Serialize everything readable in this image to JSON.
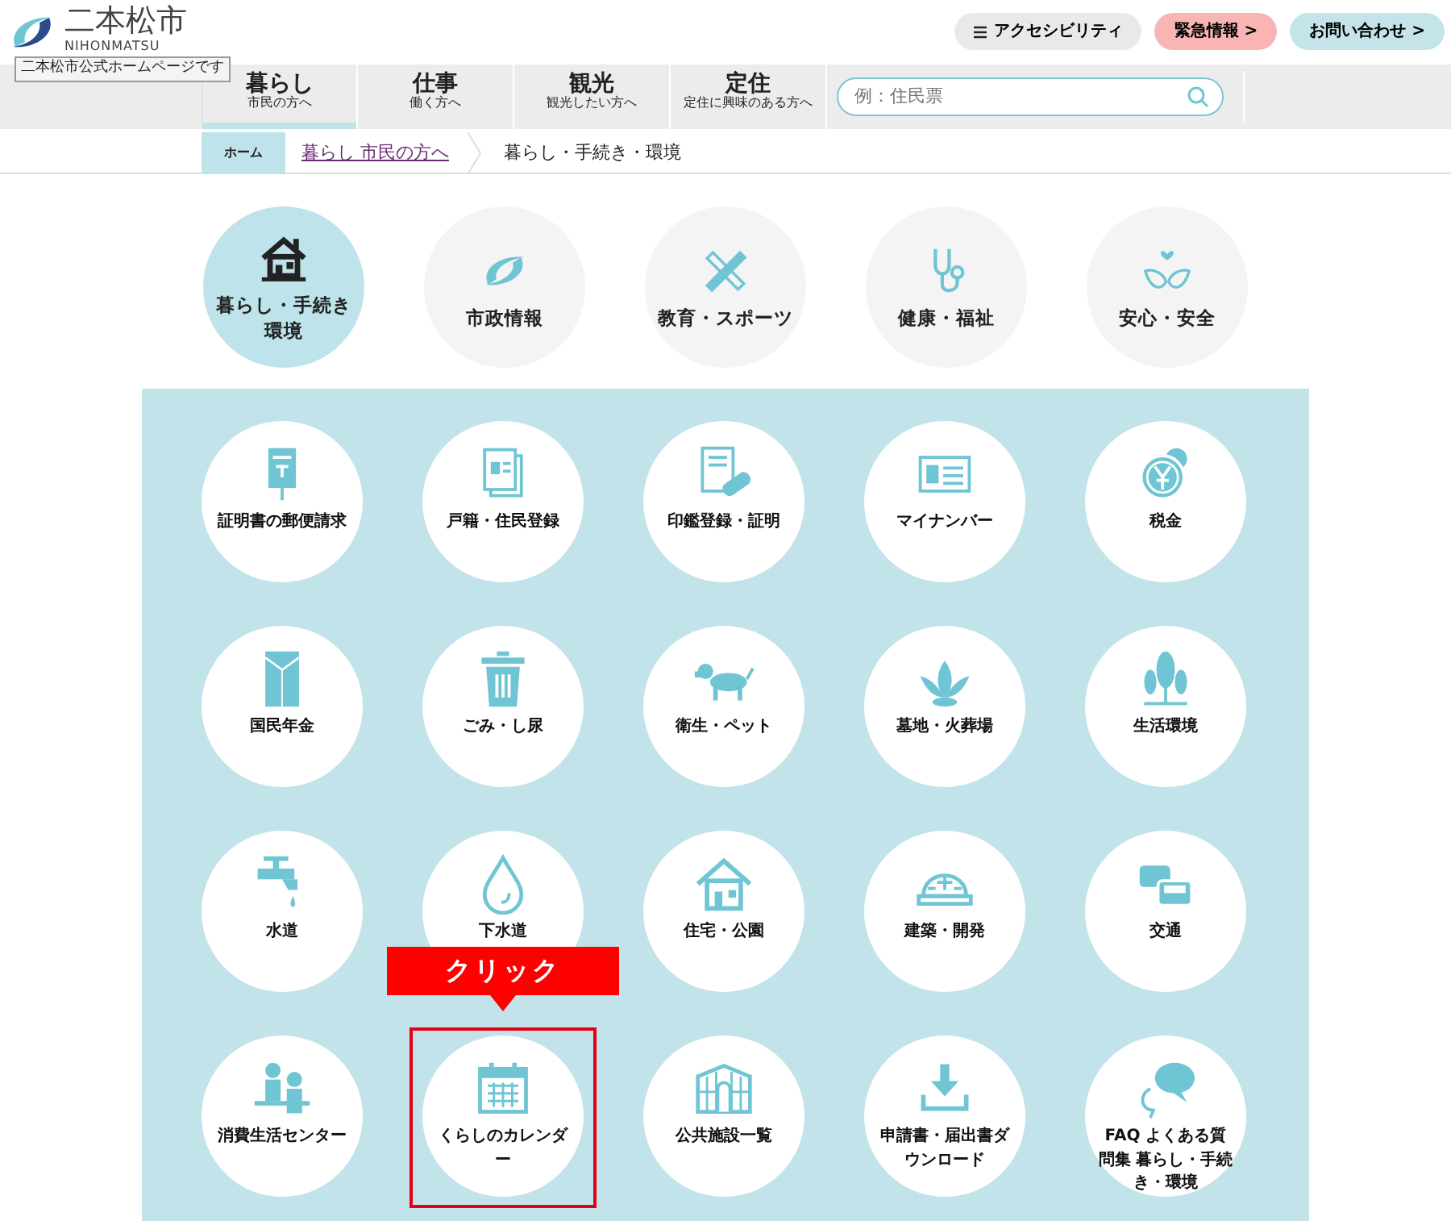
{
  "header": {
    "logo_text": "二本松市",
    "logo_subtext": "NIHONMATSU",
    "tooltip": "二本松市公式ホームページです",
    "buttons": [
      {
        "label": "アクセシビリティ",
        "kind": "menu"
      },
      {
        "label": "緊急情報 >",
        "kind": "alert"
      },
      {
        "label": "お問い合わせ >",
        "kind": "contact"
      }
    ]
  },
  "nav": {
    "items": [
      {
        "title": "暮らし",
        "subtitle": "市民の方へ",
        "selected": true
      },
      {
        "title": "仕事",
        "subtitle": "働く方へ",
        "selected": false
      },
      {
        "title": "観光",
        "subtitle": "観光したい方へ",
        "selected": false
      },
      {
        "title": "定住",
        "subtitle": "定住に興味のある方へ",
        "selected": false
      }
    ],
    "search": {
      "placeholder": "例：住民票"
    }
  },
  "breadcrumb": [
    {
      "label": "ホーム",
      "kind": "home"
    },
    {
      "label": "暮らし 市民の方へ",
      "kind": "link"
    },
    {
      "label": "暮らし・手続き・環境",
      "kind": "current"
    }
  ],
  "categories": [
    {
      "label": "暮らし・手続き環境",
      "selected": true
    },
    {
      "label": "市政情報",
      "selected": false
    },
    {
      "label": "教育・スポーツ",
      "selected": false
    },
    {
      "label": "健康・福祉",
      "selected": false
    },
    {
      "label": "安心・安全",
      "selected": false
    }
  ],
  "tiles": [
    {
      "label": "証明書の郵便請求"
    },
    {
      "label": "戸籍・住民登録"
    },
    {
      "label": "印鑑登録・証明"
    },
    {
      "label": "マイナンバー"
    },
    {
      "label": "税金"
    },
    {
      "label": "国民年金"
    },
    {
      "label": "ごみ・し尿"
    },
    {
      "label": "衛生・ペット"
    },
    {
      "label": "墓地・火葬場"
    },
    {
      "label": "生活環境"
    },
    {
      "label": "水道"
    },
    {
      "label": "下水道"
    },
    {
      "label": "住宅・公園"
    },
    {
      "label": "建築・開発"
    },
    {
      "label": "交通"
    },
    {
      "label": "消費生活センター"
    },
    {
      "label": "くらしのカレンダー",
      "highlighted": true
    },
    {
      "label": "公共施設一覧"
    },
    {
      "label": "申請書・届出書ダウンロード"
    },
    {
      "label": "FAQ よくある質問集 暮らし・手続き・環境"
    }
  ],
  "annotation": {
    "label": "クリック"
  }
}
